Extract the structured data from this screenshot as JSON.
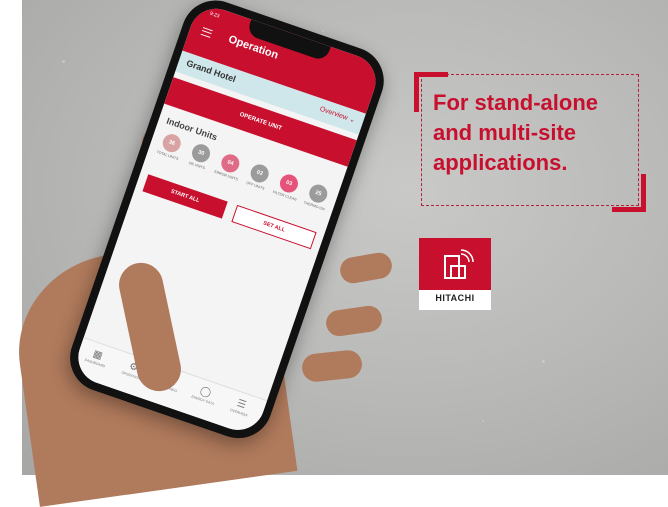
{
  "callout": {
    "lines": [
      "For stand-alone",
      "and multi-site",
      "applications."
    ]
  },
  "brand": {
    "name": "HITACHI",
    "accent_color": "#c8102e",
    "icon": "building-wifi-icon"
  },
  "phone": {
    "status_time": "9:23",
    "header_title": "Operation",
    "site_name": "Grand Hotel",
    "site_view": "Overview",
    "operate_button": "OPERATE UNIT",
    "section_title": "Indoor Units",
    "stats": [
      {
        "value": "36",
        "label": "TOTAL UNITS",
        "color": "#d9a3a3"
      },
      {
        "value": "30",
        "label": "ON UNITS",
        "color": "#9b9b9b"
      },
      {
        "value": "04",
        "label": "ERROR UNITS",
        "color": "#e06b86"
      },
      {
        "value": "02",
        "label": "OFF UNITS",
        "color": "#9b9b9b"
      },
      {
        "value": "03",
        "label": "FILTER CLEAN",
        "color": "#e5537a"
      },
      {
        "value": "25",
        "label": "THERMO ON",
        "color": "#9b9b9b"
      }
    ],
    "start_all": "START ALL",
    "set_all": "SET ALL",
    "nav": [
      {
        "label": "DASHBOARD",
        "icon": "dashboard-icon"
      },
      {
        "label": "OPERATION",
        "icon": "gear-icon"
      },
      {
        "label": "ERROR INFO",
        "icon": "warning-icon"
      },
      {
        "label": "ENERGY DATA",
        "icon": "energy-icon"
      },
      {
        "label": "OVERVIEW",
        "icon": "list-icon"
      }
    ]
  }
}
